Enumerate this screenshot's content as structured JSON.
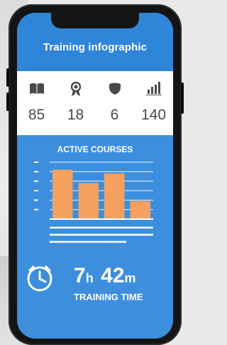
{
  "app": {
    "title": "Training infographic"
  },
  "stats": [
    {
      "icon": "book-icon",
      "value": "85"
    },
    {
      "icon": "award-ribbon-icon",
      "value": "18"
    },
    {
      "icon": "shield-icon",
      "value": "6"
    },
    {
      "icon": "bar-chart-icon",
      "value": "140"
    }
  ],
  "chart_data": {
    "type": "bar",
    "title": "ACTIVE COURSES",
    "categories": [
      "",
      "",
      "",
      ""
    ],
    "values": [
      5.2,
      3.8,
      4.8,
      1.9
    ],
    "ylim": [
      0,
      6
    ],
    "grid": true,
    "bar_color": "#f5a05e"
  },
  "training_time": {
    "hours": "7",
    "hours_unit": "h",
    "minutes": "42",
    "minutes_unit": "m",
    "label": "TRAINING TIME"
  },
  "colors": {
    "screen_blue": "#3d8fdd",
    "header_blue": "#2f86d8",
    "bar_orange": "#f5a05e",
    "stat_text": "#4a4a4a"
  }
}
